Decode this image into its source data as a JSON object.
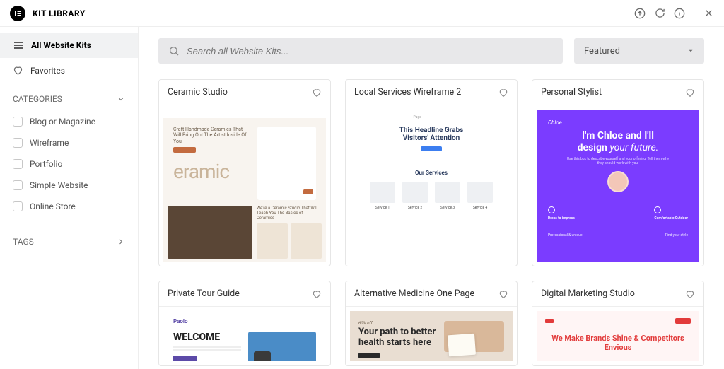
{
  "header": {
    "title": "KIT LIBRARY"
  },
  "sidebar": {
    "all": "All Website Kits",
    "favorites": "Favorites",
    "categories_label": "CATEGORIES",
    "categories": [
      "Blog or Magazine",
      "Wireframe",
      "Portfolio",
      "Simple Website",
      "Online Store"
    ],
    "tags_label": "TAGS"
  },
  "search": {
    "placeholder": "Search all Website Kits..."
  },
  "sort": {
    "label": "Featured"
  },
  "kits": [
    {
      "title": "Ceramic Studio",
      "preview": {
        "tagline": "Craft Handmade Ceramics That Will Bring Out The Artist Inside Of You",
        "brand": "eramic",
        "subhead": "We're a Ceramic Studio That Will Teach You The Basics of Ceramics"
      }
    },
    {
      "title": "Local Services Wireframe 2",
      "preview": {
        "headline1": "This Headline Grabs",
        "headline2": "Visitors' Attention",
        "services_label": "Our Services",
        "services": [
          "Service 1",
          "Service 2",
          "Service 3",
          "Service 4"
        ]
      }
    },
    {
      "title": "Personal Stylist",
      "preview": {
        "brand": "Chloe.",
        "headline_a": "I'm Chloe and I'll",
        "headline_b": "design",
        "headline_c": "your future.",
        "feat1": "Dress to impress",
        "feat2": "Comfortable Outdoor",
        "bot1": "Professional & unique",
        "bot2": "Find your style"
      }
    },
    {
      "title": "Private Tour Guide",
      "preview": {
        "brand": "Paolo",
        "headline": "WELCOME"
      }
    },
    {
      "title": "Alternative Medicine One Page",
      "preview": {
        "tag": "60% off",
        "headline": "Your path to better health starts here"
      }
    },
    {
      "title": "Digital Marketing Studio",
      "preview": {
        "headline": "We Make Brands Shine & Competitors Envious"
      }
    }
  ]
}
